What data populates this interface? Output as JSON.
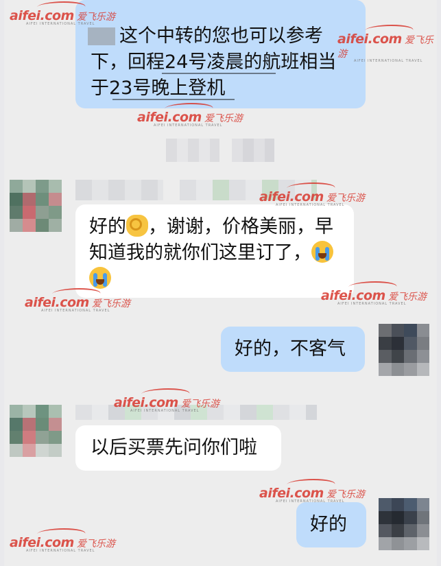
{
  "messages": [
    {
      "id": "m1",
      "side": "me",
      "lines": [
        "这个中转的您也可以参考",
        "下，回程24号凌晨的航班相当",
        "于23号晚上登机"
      ]
    },
    {
      "id": "m2",
      "side": "other",
      "text1": "好的",
      "text2": "，谢谢，价格美丽，早",
      "text3": "知道我的就你们这里订了，",
      "emoji": [
        "ok-hand-emoji",
        "crying-emoji",
        "crying-emoji"
      ]
    },
    {
      "id": "m3",
      "side": "me",
      "text": "好的，不客气"
    },
    {
      "id": "m4",
      "side": "other",
      "text": "以后买票先问你们啦"
    },
    {
      "id": "m5",
      "side": "me",
      "text": "好的"
    }
  ],
  "watermark": {
    "brand": "aifei.com",
    "chinese": "爱飞乐游",
    "sub": "AIFEI INTERNATIONAL TRAVEL"
  },
  "colors": {
    "me_bubble": "#bfdcfb",
    "other_bubble": "#ffffff",
    "watermark": "#d8392f",
    "background": "#ededed"
  }
}
